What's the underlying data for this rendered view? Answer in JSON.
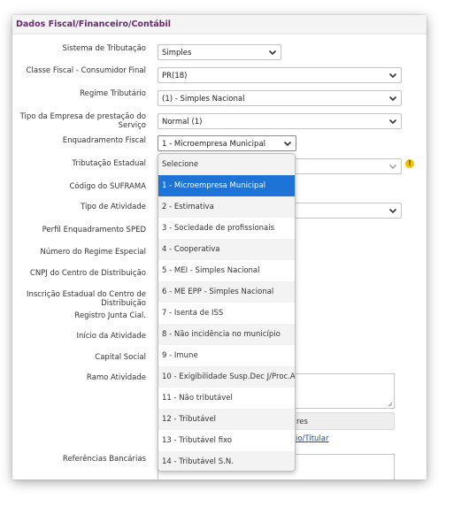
{
  "section_title": "Dados Fiscal/Financeiro/Contábil",
  "fields": {
    "sistema_tributacao": {
      "label": "Sistema de Tributação",
      "value": "Simples"
    },
    "classe_fiscal": {
      "label": "Classe Fiscal - Consumidor Final",
      "value": "PR(18)"
    },
    "regime_tributario": {
      "label": "Regime Tributário",
      "value": "(1) - Simples Nacional"
    },
    "tipo_empresa": {
      "label_line1": "Tipo da Empresa de prestação do",
      "label_line2": "Serviço",
      "value": "Normal (1)"
    },
    "enquadramento_fiscal": {
      "label": "Enquadramento Fiscal",
      "value": "1 - Microempresa Municipal"
    },
    "tributacao_estadual": {
      "label": "Tributação Estadual"
    },
    "codigo_suframa": {
      "label": "Código do SUFRAMA"
    },
    "tipo_atividade": {
      "label": "Tipo de Atividade"
    },
    "perfil_sped": {
      "label": "Perfil Enquadramento SPED"
    },
    "regime_especial": {
      "label": "Número do Regime Especial"
    },
    "cnpj_distribuicao": {
      "label": "CNPJ do Centro de Distribuição"
    },
    "ie_distribuicao": {
      "label_line1": "Inscrição Estadual do Centro de",
      "label_line2": "Distribuição"
    },
    "registro_junta": {
      "label": "Registro Junta Cial."
    },
    "inicio_atividade": {
      "label": "Início da Atividade"
    },
    "capital_social": {
      "label": "Capital Social"
    },
    "ramo_atividade": {
      "label": "Ramo Atividade"
    },
    "referencias_bancarias": {
      "label": "Referências Bancárias"
    }
  },
  "partial_table": {
    "header_fragment": "res",
    "link_fragment": "io/Titular"
  },
  "warning_icon_glyph": "!",
  "dropdown": {
    "options": [
      "Selecione",
      "1 - Microempresa Municipal",
      "2 - Estimativa",
      "3 - Sociedade de profissionais",
      "4 - Cooperativa",
      "5 - MEI - Simples Nacional",
      "6 - ME EPP - Simples Nacional",
      "7 - Isenta de ISS",
      "8 - Não incidência no município",
      "9 - Imune",
      "10 - Exigibilidade Susp.Dec J/Proc.A",
      "11 - Não tributável",
      "12 - Tributável",
      "13 - Tributável fixo",
      "14 - Tributável S.N."
    ],
    "selected_index": 1
  },
  "colors": {
    "title": "#6b2a6e",
    "selected_option": "#1d73d6",
    "link": "#1a4fa0",
    "warning": "#f2c200"
  }
}
